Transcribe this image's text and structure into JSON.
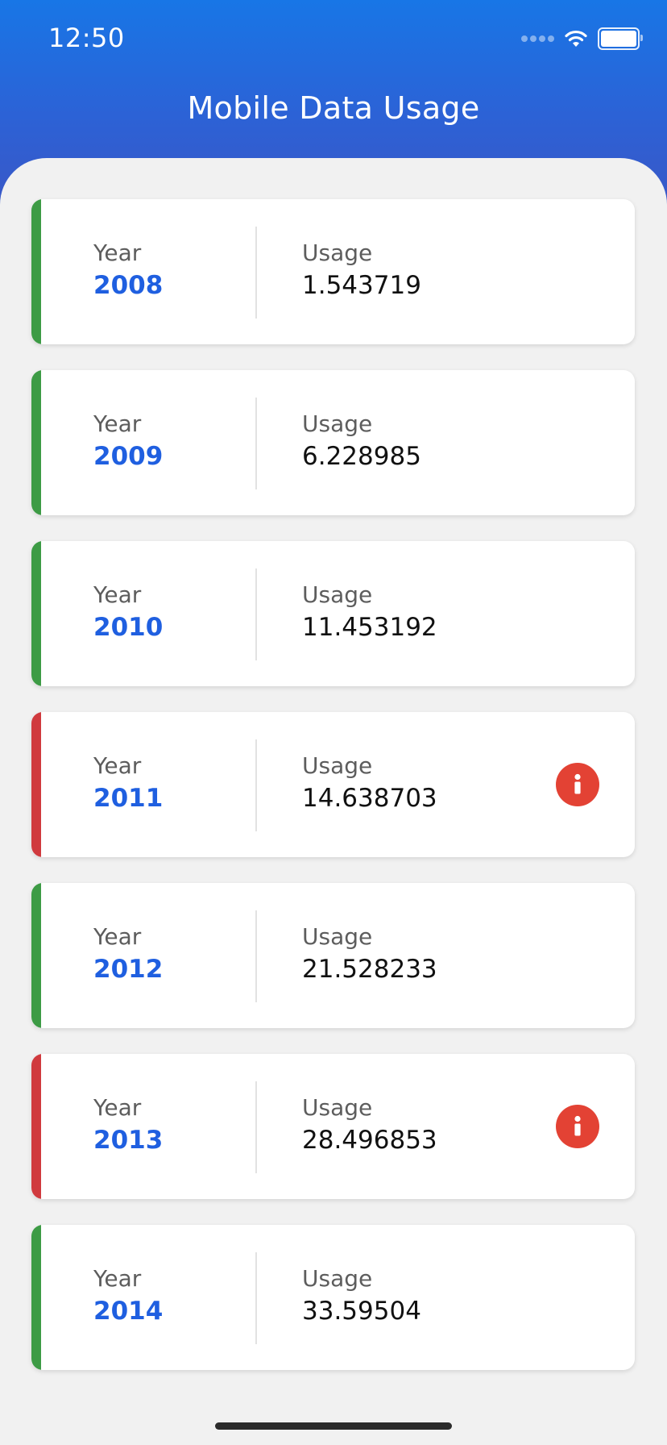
{
  "status_bar": {
    "time": "12:50"
  },
  "header": {
    "title": "Mobile Data Usage"
  },
  "colors": {
    "ok": "#3d9b45",
    "warning": "#d03a3e",
    "year_text": "#1f5fe0",
    "info_badge": "#e34234"
  },
  "labels": {
    "year": "Year",
    "usage": "Usage"
  },
  "records": [
    {
      "year": "2008",
      "usage": "1.543719",
      "status": "ok",
      "has_alert": false
    },
    {
      "year": "2009",
      "usage": "6.228985",
      "status": "ok",
      "has_alert": false
    },
    {
      "year": "2010",
      "usage": "11.453192",
      "status": "ok",
      "has_alert": false
    },
    {
      "year": "2011",
      "usage": "14.638703",
      "status": "warning",
      "has_alert": true,
      "alert_icon": "info-icon"
    },
    {
      "year": "2012",
      "usage": "21.528233",
      "status": "ok",
      "has_alert": false
    },
    {
      "year": "2013",
      "usage": "28.496853",
      "status": "warning",
      "has_alert": true,
      "alert_icon": "info-icon"
    },
    {
      "year": "2014",
      "usage": "33.59504",
      "status": "ok",
      "has_alert": false
    }
  ]
}
